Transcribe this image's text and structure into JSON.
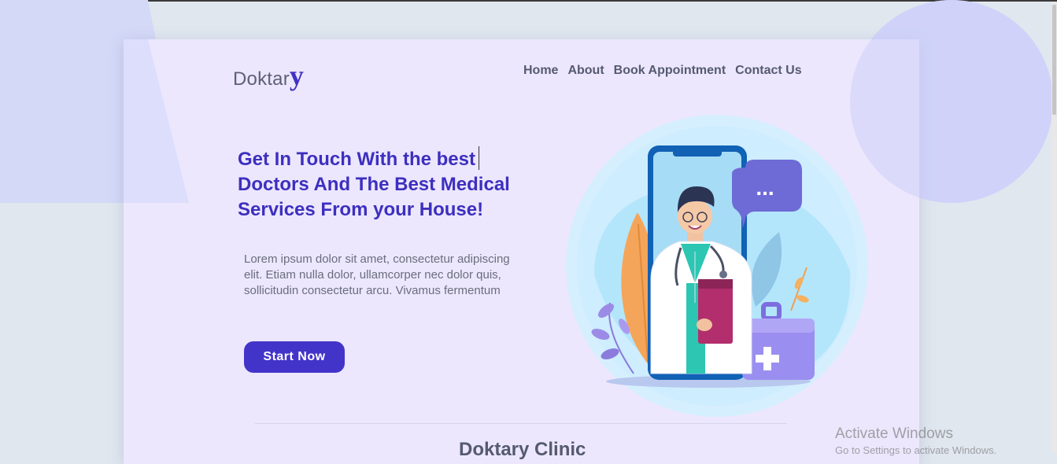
{
  "logo": {
    "prefix": "Doktar",
    "suffix": "y"
  },
  "nav": {
    "items": [
      "Home",
      "About",
      "Book Appointment",
      "Contact Us"
    ]
  },
  "hero": {
    "headline_lines": [
      "Get In Touch With the best",
      "Doctors And The Best Medical",
      "Services From your House!"
    ],
    "description": "Lorem ipsum dolor sit amet, consectetur adipiscing elit. Etiam nulla dolor, ullamcorper nec dolor quis, sollicitudin consectetur arcu. Vivamus fermentum",
    "cta_label": "Start Now",
    "chat_bubble_text": "..."
  },
  "section": {
    "title": "Doktary Clinic"
  },
  "watermark": {
    "title": "Activate Windows",
    "subtitle": "Go to Settings to activate Windows."
  },
  "colors": {
    "accent": "#4334c9",
    "heading": "#3d2fbf",
    "card_bg": "#ece7fd",
    "page_bg": "#e1e7ef"
  },
  "illustration": {
    "icons": [
      "doctor-illustration",
      "smartphone-icon",
      "chat-bubble-icon",
      "medical-kit-icon",
      "stethoscope-icon",
      "clipboard-icon"
    ]
  }
}
